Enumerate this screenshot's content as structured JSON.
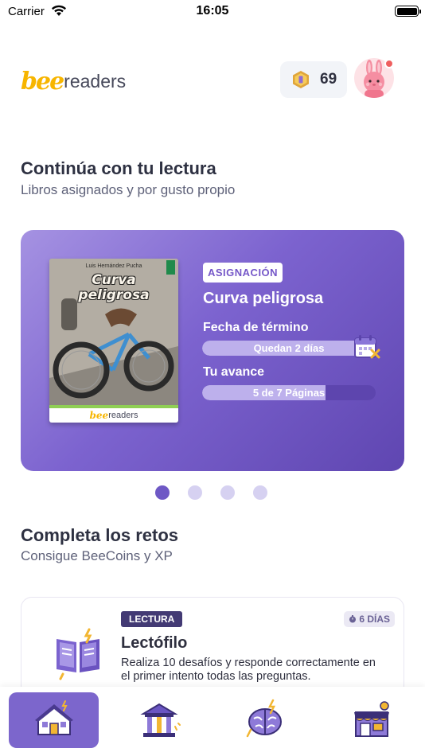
{
  "status_bar": {
    "carrier": "Carrier",
    "time": "16:05"
  },
  "header": {
    "logo_bee": "bee",
    "logo_text": "readers",
    "coins": "69",
    "has_notification": true
  },
  "reading_section": {
    "title": "Continúa con tu lectura",
    "subtitle": "Libros asignados y por gusto propio"
  },
  "current_book": {
    "cover_author": "Luis Hernández Pucha",
    "cover_title_line1": "Curva",
    "cover_title_line2": "peligrosa",
    "cover_brand_bee": "bee",
    "cover_brand_text": "readers",
    "tag": "ASIGNACIÓN",
    "title": "Curva peligrosa",
    "due_label": "Fecha de término",
    "due_text": "Quedan 2 días",
    "due_fraction": 0.88,
    "progress_label": "Tu avance",
    "progress_text": "5 de 7 Páginas",
    "progress_fraction": 0.71
  },
  "carousel": {
    "total": 4,
    "active": 0
  },
  "challenges_section": {
    "title": "Completa los retos",
    "subtitle": "Consigue BeeCoins y XP"
  },
  "challenge": {
    "tag": "LECTURA",
    "days": "6 DÍAS",
    "title": "Lectófilo",
    "description": "Realiza 10 desafíos y responde correctamente en el primer intento todas las preguntas."
  },
  "tab_bar": {
    "tabs": [
      {
        "icon": "home-icon",
        "active": true
      },
      {
        "icon": "library-icon",
        "active": false
      },
      {
        "icon": "brain-icon",
        "active": false
      },
      {
        "icon": "store-icon",
        "active": false
      }
    ]
  },
  "colors": {
    "accent": "#7c63cf",
    "brand_yellow": "#f7b500",
    "notification": "#ef5f5f"
  }
}
